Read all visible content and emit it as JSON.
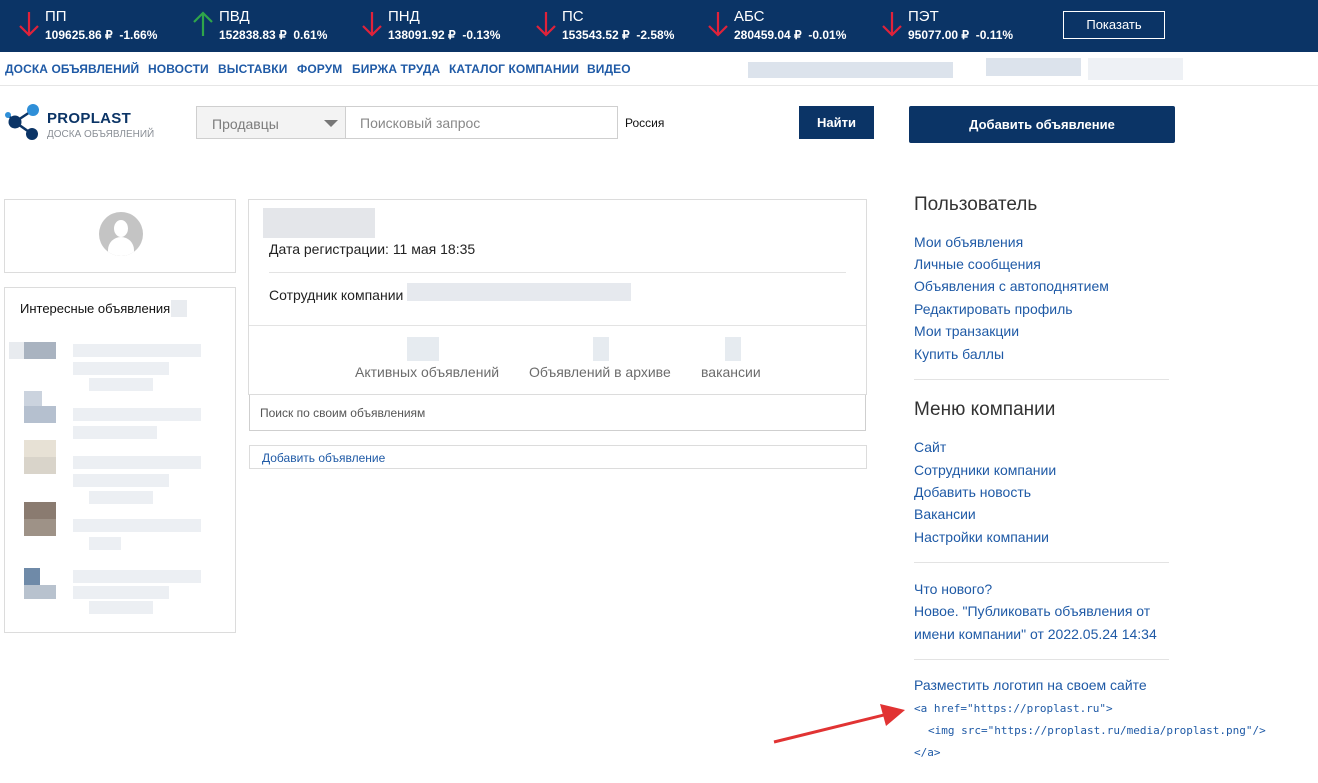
{
  "ticker": {
    "items": [
      {
        "name": "ПП",
        "price": "109625.86 ₽",
        "change": "-1.66%",
        "dir": "down"
      },
      {
        "name": "ПВД",
        "price": "152838.83 ₽",
        "change": "0.61%",
        "dir": "up"
      },
      {
        "name": "ПНД",
        "price": "138091.92 ₽",
        "change": "-0.13%",
        "dir": "down"
      },
      {
        "name": "ПС",
        "price": "153543.52 ₽",
        "change": "-2.58%",
        "dir": "down"
      },
      {
        "name": "АБС",
        "price": "280459.04 ₽",
        "change": "-0.01%",
        "dir": "down"
      },
      {
        "name": "ПЭТ",
        "price": "95077.00 ₽",
        "change": "-0.11%",
        "dir": "down"
      }
    ],
    "show_label": "Показать",
    "colors": {
      "bg": "#0b3466",
      "down": "#e0223a",
      "up": "#2fa54a"
    }
  },
  "nav": {
    "items": [
      "ДОСКА ОБЪЯВЛЕНИЙ",
      "НОВОСТИ",
      "ВЫСТАВКИ",
      "ФОРУМ",
      "БИРЖА ТРУДА",
      "КАТАЛОГ КОМПАНИИ",
      "ВИДЕО"
    ]
  },
  "header": {
    "logo_title": "PROPLAST",
    "logo_subtitle": "ДОСКА ОБЪЯВЛЕНИЙ",
    "search_category": "Продавцы",
    "search_placeholder": "Поисковый запрос",
    "search_region": "Россия",
    "find_label": "Найти",
    "add_ad_label": "Добавить объявление"
  },
  "left": {
    "interesting_title": "Интересные объявления"
  },
  "profile": {
    "reg_label": "Дата регистрации: 11 мая 18:35",
    "employee_label": "Сотрудник компании",
    "stats": [
      "Активных объявлений",
      "Объявлений в архиве",
      "вакансии"
    ],
    "own_search_placeholder": "Поиск по своим объявлениям",
    "add_ad_link": "Добавить объявление"
  },
  "user_menu": {
    "title": "Пользователь",
    "links": [
      "Мои объявления",
      "Личные сообщения",
      "Объявления с автоподнятием",
      "Редактировать профиль",
      "Мои транзакции",
      "Купить баллы"
    ]
  },
  "company_menu": {
    "title": "Меню компании",
    "links": [
      "Сайт",
      "Сотрудники компании",
      "Добавить новость",
      "Вакансии",
      "Настройки компании"
    ]
  },
  "whats_new": {
    "title": "Что нового?",
    "line1": "Новое. \"Публиковать объявления от",
    "line2": "имени компании\" от 2022.05.24 14:34"
  },
  "logo_embed": {
    "title": "Разместить логотип на своем сайте",
    "code1": "<a href=\"https://proplast.ru\">",
    "code2": "<img src=\"https://proplast.ru/media/proplast.png\"/>",
    "code3": "</a>"
  }
}
